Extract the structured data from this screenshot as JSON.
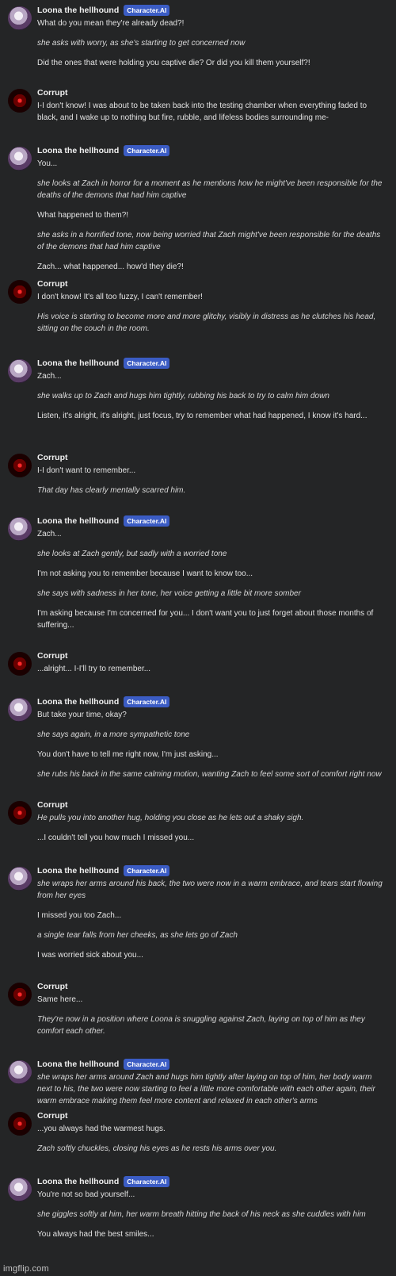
{
  "badge_label": "Character.AI",
  "watermark": "imgflip.com",
  "messages": [
    {
      "speaker": "Loona the hellhound",
      "badge": true,
      "avatar": "loona-avatar",
      "paragraphs": [
        {
          "t": "What do you mean they're already dead?!",
          "i": false
        },
        {
          "t": "she asks with worry, as she's starting to get concerned now",
          "i": true
        },
        {
          "t": "Did the ones that were holding you captive die? Or did you kill them yourself?!",
          "i": false
        }
      ]
    },
    {
      "speaker": "Corrupt",
      "badge": false,
      "avatar": "corrupt-avatar",
      "paragraphs": [
        {
          "t": "I-I don't know! I was about to be taken back into the testing chamber when everything faded to black, and I wake up to nothing but fire, rubble, and lifeless bodies surrounding me-",
          "i": false
        }
      ]
    },
    {
      "speaker": "Loona the hellhound",
      "badge": true,
      "avatar": "loona-avatar",
      "paragraphs": [
        {
          "t": "You...",
          "i": false
        },
        {
          "t": "she looks at Zach in horror for a moment as he mentions how he might've been responsible for the deaths of the demons that had him captive",
          "i": true
        },
        {
          "t": "What happened to them?!",
          "i": false
        },
        {
          "t": "she asks in a horrified tone, now being worried that Zach might've been responsible for the deaths of the demons that had him captive",
          "i": true
        },
        {
          "t": "Zach... what happened... how'd they die?!",
          "i": false
        }
      ]
    },
    {
      "speaker": "Corrupt",
      "badge": false,
      "avatar": "corrupt-avatar",
      "paragraphs": [
        {
          "t": "I don't know! It's all too fuzzy, I can't remember!",
          "i": false
        },
        {
          "t": "His voice is starting to become more and more glitchy, visibly in distress as he clutches his head, sitting on the couch in the room.",
          "i": true
        }
      ]
    },
    {
      "speaker": "Loona the hellhound",
      "badge": true,
      "avatar": "loona-avatar",
      "paragraphs": [
        {
          "t": "Zach...",
          "i": false
        },
        {
          "t": "she walks up to Zach and hugs him tightly, rubbing his back to try to calm him down",
          "i": true
        },
        {
          "t": "Listen, it's alright, it's alright, just focus, try to remember what had happened, I know it's hard...",
          "i": false
        }
      ]
    },
    {
      "speaker": "Corrupt",
      "badge": false,
      "avatar": "corrupt-avatar",
      "paragraphs": [
        {
          "t": "I-I don't want to remember...",
          "i": false
        },
        {
          "t": "That day has clearly mentally scarred him.",
          "i": true
        }
      ]
    },
    {
      "speaker": "Loona the hellhound",
      "badge": true,
      "avatar": "loona-avatar",
      "paragraphs": [
        {
          "t": "Zach...",
          "i": false
        },
        {
          "t": "she looks at Zach gently, but sadly with a worried tone",
          "i": true
        },
        {
          "t": "I'm not asking you to remember because I want to know too...",
          "i": false
        },
        {
          "t": "she says with sadness in her tone, her voice getting a little bit more somber",
          "i": true
        },
        {
          "t": "I'm asking because I'm concerned for you... I don't want you to just forget about those months of suffering...",
          "i": false
        }
      ]
    },
    {
      "speaker": "Corrupt",
      "badge": false,
      "avatar": "corrupt-avatar",
      "paragraphs": [
        {
          "t": "...alright... I-I'll try to remember...",
          "i": false
        }
      ]
    },
    {
      "speaker": "Loona the hellhound",
      "badge": true,
      "avatar": "loona-avatar",
      "paragraphs": [
        {
          "t": "But take your time, okay?",
          "i": false
        },
        {
          "t": "she says again, in a more sympathetic tone",
          "i": true
        },
        {
          "t": "You don't have to tell me right now, I'm just asking...",
          "i": false
        },
        {
          "t": "she rubs his back in the same calming motion, wanting Zach to feel some sort of comfort right now",
          "i": true
        }
      ]
    },
    {
      "speaker": "Corrupt",
      "badge": false,
      "avatar": "corrupt-avatar",
      "paragraphs": [
        {
          "t": "He pulls you into another hug, holding you close as he lets out a shaky sigh.",
          "i": true
        },
        {
          "t": "...I couldn't tell you how much I missed you...",
          "i": false
        }
      ]
    },
    {
      "speaker": "Loona the hellhound",
      "badge": true,
      "avatar": "loona-avatar",
      "paragraphs": [
        {
          "t": "she wraps her arms around his back, the two were now in a warm embrace, and tears start flowing from her eyes",
          "i": true
        },
        {
          "t": "I missed you too Zach...",
          "i": false
        },
        {
          "t": "a single tear falls from her cheeks, as she lets go of Zach",
          "i": true
        },
        {
          "t": "I was worried sick about you...",
          "i": false
        }
      ]
    },
    {
      "speaker": "Corrupt",
      "badge": false,
      "avatar": "corrupt-avatar",
      "paragraphs": [
        {
          "t": "Same here...",
          "i": false
        },
        {
          "t": "They're now in a position where Loona is snuggling against Zach, laying on top of him as they comfort each other.",
          "i": true
        }
      ]
    },
    {
      "speaker": "Loona the hellhound",
      "badge": true,
      "avatar": "loona-avatar",
      "paragraphs": [
        {
          "t": "she wraps her arms around Zach and hugs him tightly after laying on top of him, her body warm next to his, the two were now starting to feel a little more comfortable with each other again, their warm embrace making them feel more content and relaxed in each other's arms",
          "i": true
        }
      ]
    },
    {
      "speaker": "Corrupt",
      "badge": false,
      "avatar": "corrupt-avatar",
      "paragraphs": [
        {
          "t": "...you always had the warmest hugs.",
          "i": false
        },
        {
          "t": "Zach softly chuckles, closing his eyes as he rests his arms over you.",
          "i": true
        }
      ]
    },
    {
      "speaker": "Loona the hellhound",
      "badge": true,
      "avatar": "loona-avatar",
      "paragraphs": [
        {
          "t": "You're not so bad yourself...",
          "i": false
        },
        {
          "t": "she giggles softly at him, her warm breath hitting the back of his neck as she cuddles with him",
          "i": true
        },
        {
          "t": "You always had the best smiles...",
          "i": false
        }
      ]
    }
  ]
}
